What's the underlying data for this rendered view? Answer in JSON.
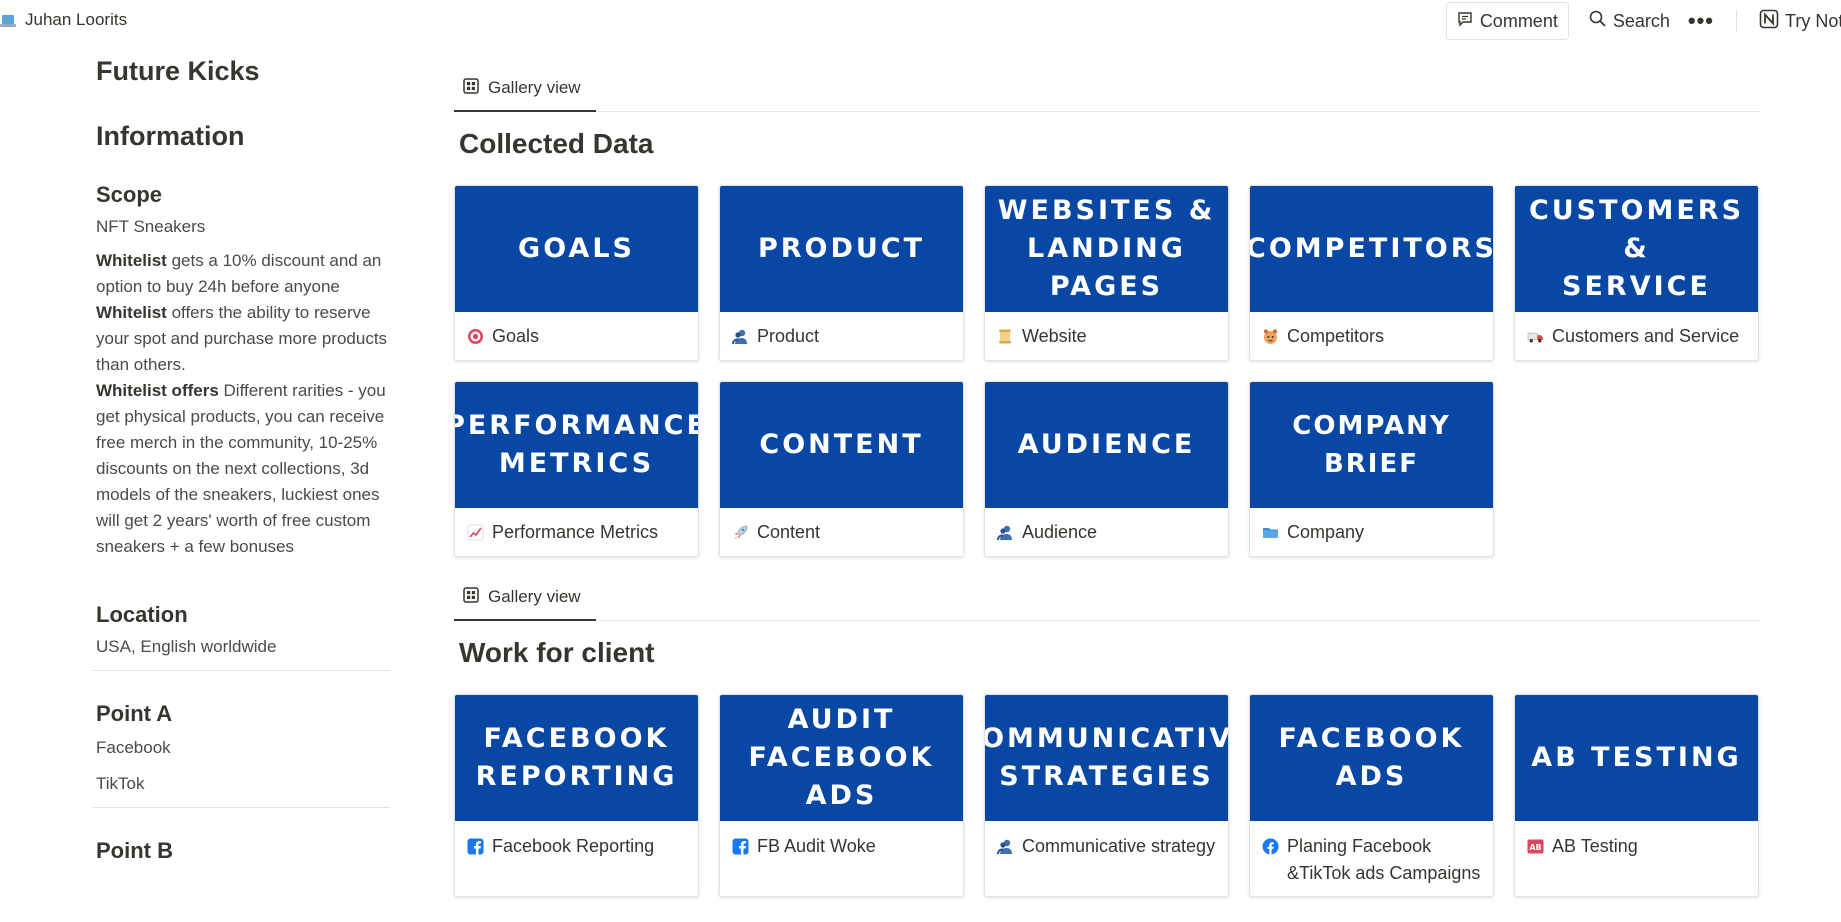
{
  "topbar": {
    "workspace_name": "Juhan Loorits",
    "comment_label": "Comment",
    "search_label": "Search",
    "more_label": "•••",
    "try_label": "Try Notion"
  },
  "left": {
    "page_title": "Future Kicks",
    "info_heading": "Information",
    "scope_heading": "Scope",
    "scope_value": "NFT Sneakers",
    "para1_bold": "Whitelist",
    "para1_text": " gets a 10% discount and an option to buy 24h before anyone",
    "para2_bold": "Whitelist",
    "para2_text": " offers the ability to reserve your spot and purchase more products than others.",
    "para3_bold": "Whitelist offers",
    "para3_text": " Different rarities - you get physical products, you can receive free merch in the community, 10-25% discounts on the next collections, 3d models of the sneakers, luckiest ones will get 2 years' worth of free custom sneakers + a few bonuses",
    "location_heading": "Location",
    "location_value": "USA, English worldwide",
    "pointa_heading": "Point A",
    "pointa_items": [
      "Facebook",
      "TikTok"
    ],
    "pointb_heading": "Point B"
  },
  "sections": [
    {
      "tab_label": "Gallery view",
      "title": "Collected Data",
      "cards": [
        {
          "cover": "GOALS",
          "caption": "Goals",
          "icon": "target-icon"
        },
        {
          "cover": "PRODUCT",
          "caption": "Product",
          "icon": "person-icon"
        },
        {
          "cover": "WEBSITES &\nLANDING PAGES",
          "caption": "Website",
          "icon": "scroll-icon"
        },
        {
          "cover": "COMPETITORS",
          "caption": "Competitors",
          "icon": "face-icon"
        },
        {
          "cover": "CUSTOMERS &\nSERVICE",
          "caption": "Customers and Service",
          "icon": "truck-icon"
        },
        {
          "cover": "PERFORMANCE\nMETRICS",
          "caption": "Performance Metrics",
          "icon": "chart-icon"
        },
        {
          "cover": "CONTENT",
          "caption": "Content",
          "icon": "rocket-icon"
        },
        {
          "cover": "AUDIENCE",
          "caption": "Audience",
          "icon": "person-icon"
        },
        {
          "cover": "COMPANY BRIEF",
          "caption": "Company",
          "icon": "folder-icon"
        }
      ]
    },
    {
      "tab_label": "Gallery view",
      "title": "Work for client",
      "cards": [
        {
          "cover": "FACEBOOK\nREPORTING",
          "caption": "Facebook Reporting",
          "icon": "facebook-square-icon"
        },
        {
          "cover": "AUDIT\nFACEBOOK ADS",
          "caption": "FB Audit Woke",
          "icon": "facebook-square-icon"
        },
        {
          "cover": "COMMUNICATIVE\nSTRATEGIES",
          "caption": "Communicative strategy",
          "icon": "person-icon"
        },
        {
          "cover": "FACEBOOK\nADS",
          "caption": "Planing Facebook &TikTok ads Campaigns",
          "icon": "facebook-round-icon"
        },
        {
          "cover": "AB TESTING",
          "caption": "AB Testing",
          "icon": "ab-icon"
        }
      ]
    }
  ]
}
